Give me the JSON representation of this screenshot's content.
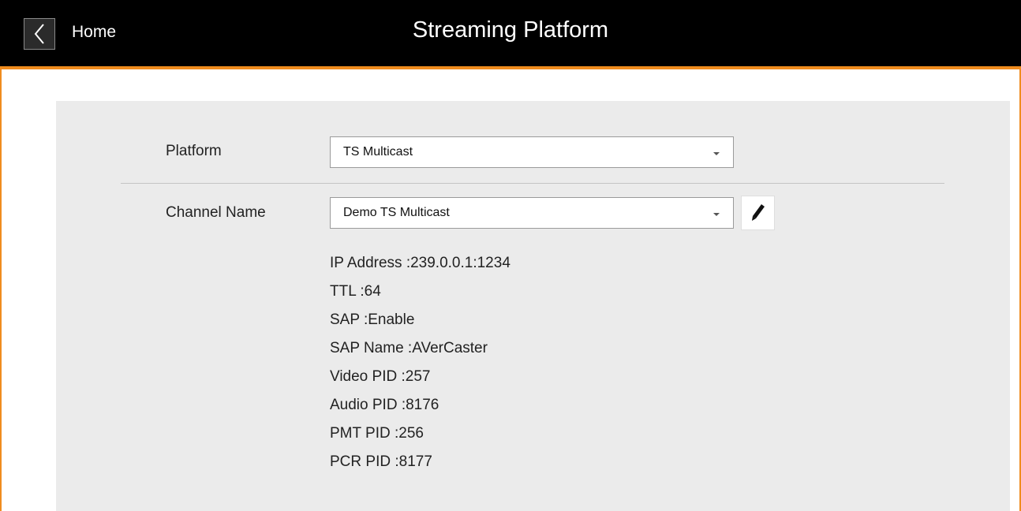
{
  "header": {
    "back_icon": "chevron-left-icon",
    "home_label": "Home",
    "title": "Streaming Platform"
  },
  "colors": {
    "header_bg": "#000000",
    "accent": "#f08c1e",
    "panel_bg": "#ebebeb"
  },
  "form": {
    "platform": {
      "label": "Platform",
      "selected": "TS Multicast"
    },
    "channel": {
      "label": "Channel Name",
      "selected": "Demo TS Multicast",
      "edit_icon": "pencil-icon"
    },
    "details": [
      "IP Address :239.0.0.1:1234",
      "TTL :64",
      "SAP :Enable",
      "SAP Name :AVerCaster",
      "Video PID :257",
      "Audio PID :8176",
      "PMT PID :256",
      "PCR PID :8177"
    ]
  }
}
